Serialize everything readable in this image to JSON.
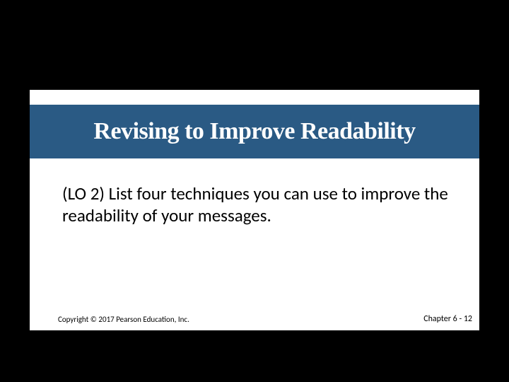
{
  "slide": {
    "title": "Revising to Improve Readability",
    "body": "(LO 2) List four techniques you can use to improve the readability of your messages.",
    "copyright": "Copyright © 2017 Pearson Education, Inc.",
    "chapter_page": "Chapter 6 - 12"
  }
}
